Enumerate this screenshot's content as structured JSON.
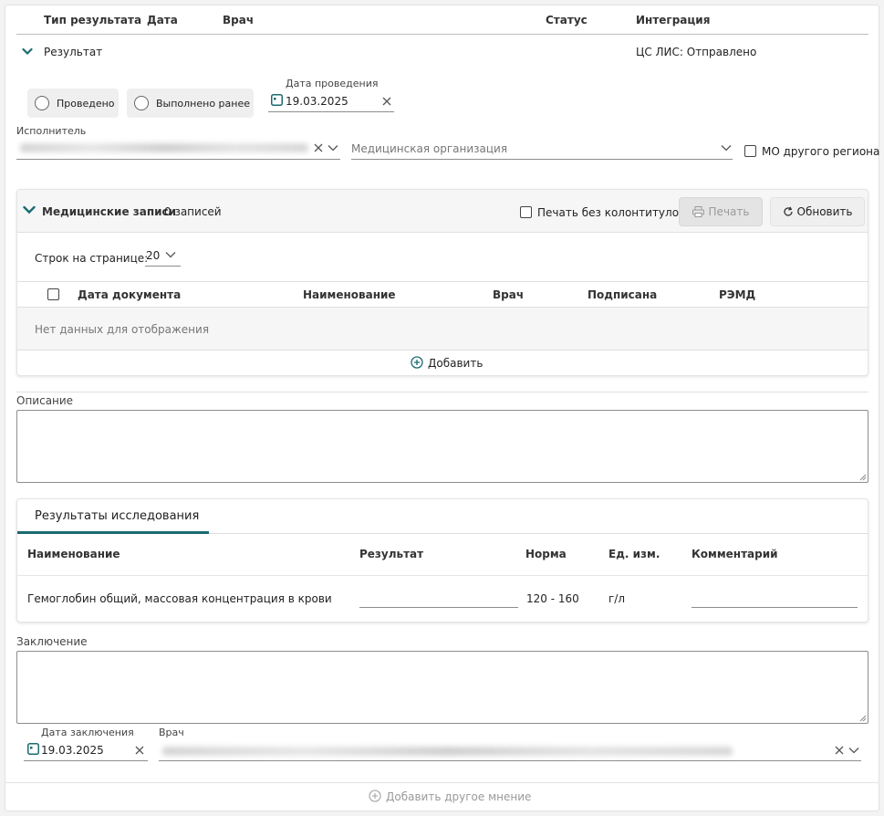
{
  "header": {
    "col_type": "Тип результата",
    "col_date": "Дата",
    "col_doctor": "Врач",
    "col_status": "Статус",
    "col_integration": "Интеграция"
  },
  "result_row": {
    "type": "Результат",
    "integration": "ЦС ЛИС: Отправлено"
  },
  "execution": {
    "radio_done": "Проведено",
    "radio_done_earlier": "Выполнено ранее",
    "date_label": "Дата проведения",
    "date_value": "19.03.2025"
  },
  "executor": {
    "label": "Исполнитель",
    "org_placeholder": "Медицинская организация",
    "other_region_label": "МО другого региона"
  },
  "records": {
    "title": "Медицинские записи",
    "count": "0 записей",
    "print_no_headers": "Печать без колонтитулов",
    "print_button": "Печать",
    "refresh_button": "Обновить",
    "rows_per_page_label": "Строк на странице:",
    "rows_per_page_value": "20",
    "columns": [
      "Дата документа",
      "Наименование",
      "Врач",
      "Подписана",
      "РЭМД"
    ],
    "empty_text": "Нет данных для отображения",
    "add_button": "Добавить"
  },
  "description": {
    "label": "Описание"
  },
  "research": {
    "tab_label": "Результаты исследования",
    "columns": [
      "Наименование",
      "Результат",
      "Норма",
      "Ед. изм.",
      "Комментарий"
    ],
    "rows": [
      {
        "name": "Гемоглобин общий, массовая концентрация в крови",
        "result": "",
        "norm": "120 - 160",
        "unit": "г/л",
        "comment": ""
      }
    ]
  },
  "conclusion": {
    "label": "Заключение",
    "date_label": "Дата заключения",
    "date_value": "19.03.2025",
    "doctor_label": "Врач"
  },
  "footer": {
    "add_opinion": "Добавить другое мнение"
  },
  "colors": {
    "accent": "#1a6b70",
    "border": "#cfcfcf",
    "disabled_text": "#9a9a9a"
  }
}
